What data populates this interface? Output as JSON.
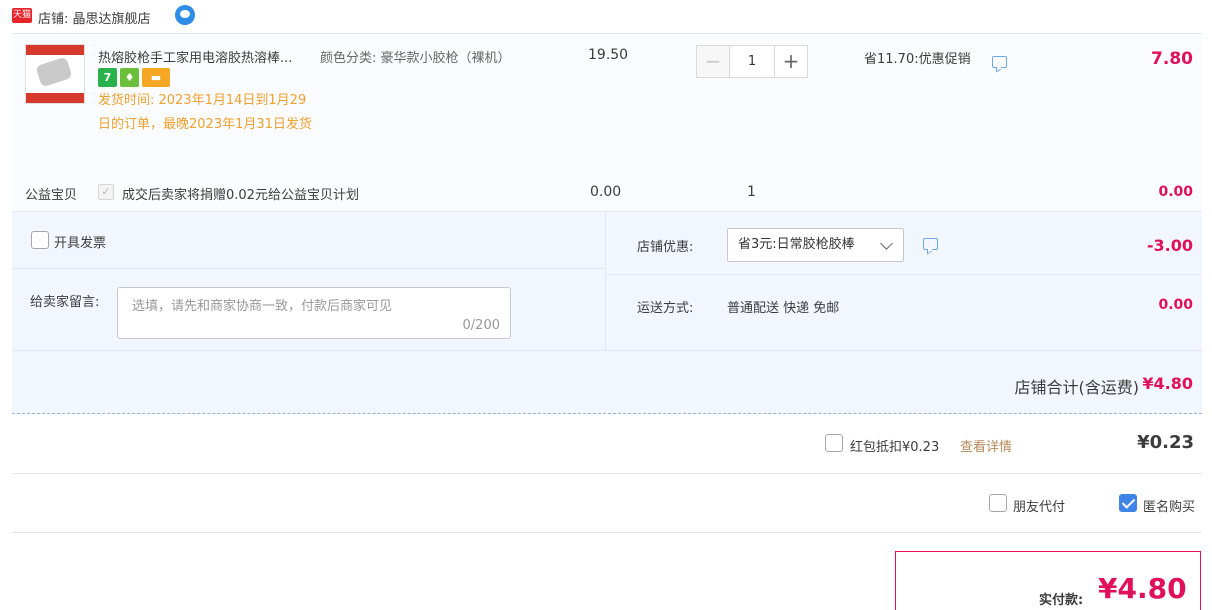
{
  "shop": {
    "badge": "天猫",
    "label": "店铺: 晶思达旗舰店"
  },
  "item": {
    "title": "热熔胶枪手工家用电溶胶热溶棒...",
    "sku": "颜色分类: 豪华款小胶枪（裸机）",
    "service_icons": [
      "7",
      "♦",
      "▬"
    ],
    "delivery": "发货时间: 2023年1月14日到1月29日的订单，最晚2023年1月31日发货",
    "price": "19.50",
    "quantity": "1",
    "promo": "省11.70:优惠促销",
    "subtotal": "7.80"
  },
  "charity": {
    "label": "公益宝贝",
    "text": "成交后卖家将捐赠0.02元给公益宝贝计划",
    "price": "0.00",
    "quantity": "1",
    "subtotal": "0.00"
  },
  "invoice": {
    "label": "开具发票"
  },
  "note": {
    "label": "给卖家留言:",
    "placeholder": "选填，请先和商家协商一致，付款后商家可见",
    "count": "0/200"
  },
  "discount": {
    "label": "店铺优惠:",
    "selected": "省3元:日常胶枪胶棒",
    "amount": "-3.00"
  },
  "shipping": {
    "label": "运送方式:",
    "value": "普通配送 快递 免邮",
    "amount": "0.00"
  },
  "shop_total": {
    "label": "店铺合计(含运费)",
    "amount": "¥4.80"
  },
  "redpack": {
    "label": "红包抵扣¥0.23",
    "link": "查看详情",
    "amount": "¥0.23",
    "checked": false
  },
  "options": {
    "friend_pay": {
      "label": "朋友代付",
      "checked": false
    },
    "anonymous": {
      "label": "匿名购买",
      "checked": true
    }
  },
  "payment": {
    "label": "实付款:",
    "amount": "¥4.80"
  },
  "colors": {
    "accent_red": "#e0115a",
    "panel_bg": "#f2f7ff",
    "delivery_orange": "#f0a030",
    "check_blue": "#3f84e8"
  }
}
